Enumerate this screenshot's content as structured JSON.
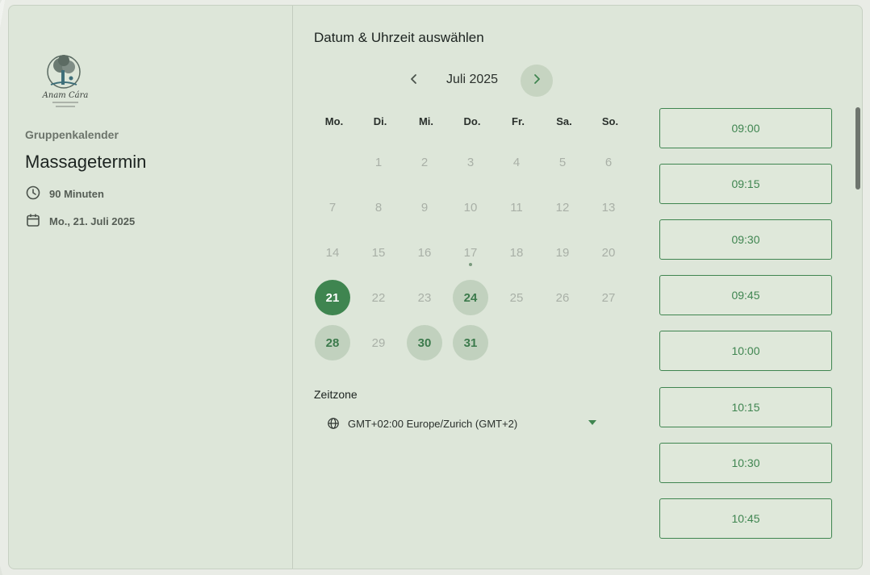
{
  "sidebar": {
    "logo_text": "Anam Cára",
    "group_label": "Gruppenkalender",
    "title": "Massagetermin",
    "duration": "90 Minuten",
    "selected_date": "Mo., 21. Juli 2025",
    "icons": [
      "clock-icon",
      "calendar-icon"
    ]
  },
  "calendar": {
    "section_title": "Datum & Uhrzeit auswählen",
    "month": "Juli 2025",
    "weekdays": [
      "Mo.",
      "Di.",
      "Mi.",
      "Do.",
      "Fr.",
      "Sa.",
      "So."
    ],
    "start_offset": 1,
    "days_in_month": 31,
    "today": 17,
    "selected": 21,
    "available": [
      24,
      28,
      30,
      31
    ],
    "accent_color": "#3f8550"
  },
  "timezone": {
    "label": "Zeitzone",
    "value": "GMT+02:00 Europe/Zurich (GMT+2)"
  },
  "slots": [
    "09:00",
    "09:15",
    "09:30",
    "09:45",
    "10:00",
    "10:15",
    "10:30",
    "10:45"
  ]
}
